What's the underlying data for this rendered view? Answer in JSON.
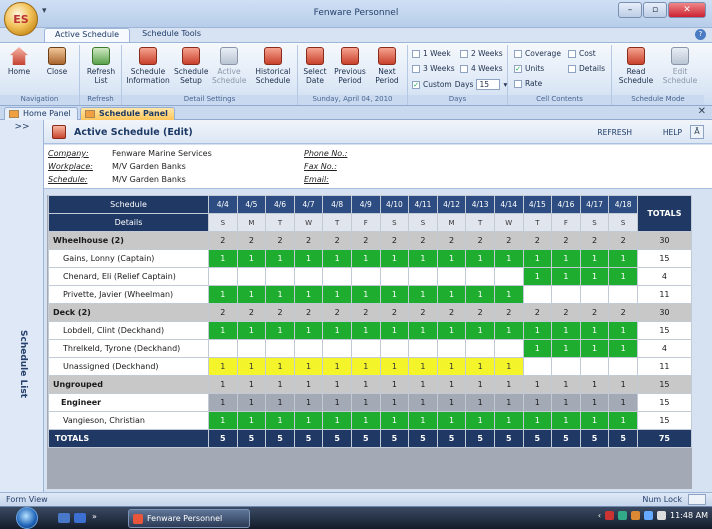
{
  "window": {
    "title": "Fenware Personnel",
    "orb_label": "ES",
    "qat": "▾"
  },
  "ribbon_tabs": [
    "Active Schedule",
    "Schedule Tools"
  ],
  "ribbon": {
    "navigation": {
      "label": "Navigation",
      "home": "Home",
      "close": "Close"
    },
    "refresh": {
      "label": "Refresh",
      "refresh_list": "Refresh\nList"
    },
    "detail_settings": {
      "label": "Detail Settings",
      "schedule_information": "Schedule\nInformation",
      "schedule_setup": "Schedule\nSetup",
      "active_schedule": "Active\nSchedule",
      "historical_schedule": "Historical\nSchedule"
    },
    "date": {
      "label": "Sunday, April 04, 2010",
      "select_date": "Select\nDate",
      "previous_period": "Previous\nPeriod",
      "next_period": "Next\nPeriod"
    },
    "days": {
      "label": "Days",
      "w1": "1 Week",
      "w2": "2 Weeks",
      "w3": "3 Weeks",
      "w4": "4 Weeks",
      "custom": "Custom",
      "days_label": "Days",
      "days_value": "15"
    },
    "cell_contents": {
      "label": "Cell Contents",
      "coverage": "Coverage",
      "cost": "Cost",
      "units": "Units",
      "details": "Details",
      "rate": "Rate"
    },
    "schedule_mode": {
      "label": "Schedule Mode",
      "read": "Read\nSchedule",
      "edit": "Edit\nSchedule"
    }
  },
  "doc_tabs": [
    "Home Panel",
    "Schedule Panel"
  ],
  "side": {
    "expand": ">>",
    "label": "Schedule List"
  },
  "main": {
    "title": "Active Schedule (Edit)",
    "refresh": "REFRESH",
    "help": "HELP",
    "collapse": "Ā"
  },
  "info": {
    "company_label": "Company:",
    "company": "Fenware Marine Services",
    "workplace_label": "Workplace:",
    "workplace": "M/V Garden Banks",
    "schedule_label": "Schedule:",
    "schedule": "M/V Garden Banks",
    "phone_label": "Phone No.:",
    "fax_label": "Fax No.:",
    "email_label": "Email:"
  },
  "grid": {
    "header_schedule": "Schedule",
    "header_details": "Details",
    "header_totals": "TOTALS",
    "dates": [
      "4/4",
      "4/5",
      "4/6",
      "4/7",
      "4/8",
      "4/9",
      "4/10",
      "4/11",
      "4/12",
      "4/13",
      "4/14",
      "4/15",
      "4/16",
      "4/17",
      "4/18"
    ],
    "days": [
      "S",
      "M",
      "T",
      "W",
      "T",
      "F",
      "S",
      "S",
      "M",
      "T",
      "W",
      "T",
      "F",
      "S",
      "S"
    ],
    "rows": [
      {
        "type": "grp",
        "name": "Wheelhouse (2)",
        "cells": [
          "2",
          "2",
          "2",
          "2",
          "2",
          "2",
          "2",
          "2",
          "2",
          "2",
          "2",
          "2",
          "2",
          "2",
          "2"
        ],
        "fill": "",
        "total": "30"
      },
      {
        "type": "person",
        "name": "Gains, Lonny (Captain)",
        "cells": [
          "1",
          "1",
          "1",
          "1",
          "1",
          "1",
          "1",
          "1",
          "1",
          "1",
          "1",
          "1",
          "1",
          "1",
          "1"
        ],
        "fill": "ggggggggggggggg",
        "total": "15"
      },
      {
        "type": "person",
        "name": "Chenard, Eli (Relief Captain)",
        "cells": [
          "",
          "",
          "",
          "",
          "",
          "",
          "",
          "",
          "",
          "",
          "",
          "1",
          "1",
          "1",
          "1"
        ],
        "fill": "wwwwwwwwwwwgggg",
        "total": "4"
      },
      {
        "type": "person",
        "name": "Privette, Javier (Wheelman)",
        "cells": [
          "1",
          "1",
          "1",
          "1",
          "1",
          "1",
          "1",
          "1",
          "1",
          "1",
          "1",
          "",
          "",
          "",
          ""
        ],
        "fill": "gggggggggggwwww",
        "total": "11"
      },
      {
        "type": "grp",
        "name": "Deck (2)",
        "cells": [
          "2",
          "2",
          "2",
          "2",
          "2",
          "2",
          "2",
          "2",
          "2",
          "2",
          "2",
          "2",
          "2",
          "2",
          "2"
        ],
        "fill": "",
        "total": "30"
      },
      {
        "type": "person",
        "name": "Lobdell, Clint (Deckhand)",
        "cells": [
          "1",
          "1",
          "1",
          "1",
          "1",
          "1",
          "1",
          "1",
          "1",
          "1",
          "1",
          "1",
          "1",
          "1",
          "1"
        ],
        "fill": "ggggggggggggggg",
        "total": "15"
      },
      {
        "type": "person",
        "name": "Threlkeld, Tyrone (Deckhand)",
        "cells": [
          "",
          "",
          "",
          "",
          "",
          "",
          "",
          "",
          "",
          "",
          "",
          "1",
          "1",
          "1",
          "1"
        ],
        "fill": "wwwwwwwwwwwgggg",
        "total": "4"
      },
      {
        "type": "person",
        "name": "Unassigned (Deckhand)",
        "cells": [
          "1",
          "1",
          "1",
          "1",
          "1",
          "1",
          "1",
          "1",
          "1",
          "1",
          "1",
          "",
          "",
          "",
          ""
        ],
        "fill": "yyyyyyyyyyywwww",
        "total": "11"
      },
      {
        "type": "grp",
        "name": "Ungrouped",
        "cells": [
          "1",
          "1",
          "1",
          "1",
          "1",
          "1",
          "1",
          "1",
          "1",
          "1",
          "1",
          "1",
          "1",
          "1",
          "1"
        ],
        "fill": "",
        "total": "15"
      },
      {
        "type": "sub",
        "name": "Engineer",
        "cells": [
          "1",
          "1",
          "1",
          "1",
          "1",
          "1",
          "1",
          "1",
          "1",
          "1",
          "1",
          "1",
          "1",
          "1",
          "1"
        ],
        "fill": "",
        "total": "15"
      },
      {
        "type": "person",
        "name": "Vangieson, Christian",
        "cells": [
          "1",
          "1",
          "1",
          "1",
          "1",
          "1",
          "1",
          "1",
          "1",
          "1",
          "1",
          "1",
          "1",
          "1",
          "1"
        ],
        "fill": "ggggggggggggggg",
        "total": "15"
      }
    ],
    "totals": {
      "name": "TOTALS",
      "cells": [
        "5",
        "5",
        "5",
        "5",
        "5",
        "5",
        "5",
        "5",
        "5",
        "5",
        "5",
        "5",
        "5",
        "5",
        "5"
      ],
      "total": "75"
    }
  },
  "status": {
    "left": "Form View",
    "right": "Num Lock"
  },
  "taskbar": {
    "app": "Fenware Personnel",
    "time": "11:48 AM"
  },
  "colors": {
    "green": "#1fad2f",
    "yellow": "#f4f42a",
    "navy": "#1f3864",
    "group_grey": "#c8c8c8"
  }
}
